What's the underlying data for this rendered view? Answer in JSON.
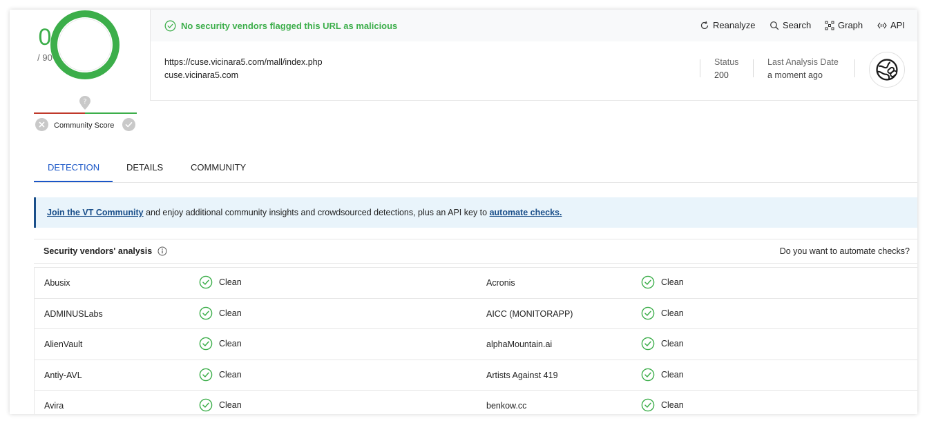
{
  "score": {
    "detections": "0",
    "total": "/ 90"
  },
  "community": {
    "label": "Community Score"
  },
  "header": {
    "verdict": "No security vendors flagged this URL as malicious",
    "actions": [
      {
        "label": "Reanalyze",
        "icon": "refresh-icon"
      },
      {
        "label": "Search",
        "icon": "search-icon"
      },
      {
        "label": "Graph",
        "icon": "graph-icon"
      },
      {
        "label": "API",
        "icon": "api-icon"
      }
    ],
    "url": "https://cuse.vicinara5.com/mall/index.php",
    "domain": "cuse.vicinara5.com",
    "status_label": "Status",
    "status_value": "200",
    "date_label": "Last Analysis Date",
    "date_value": "a moment ago"
  },
  "tabs": [
    {
      "label": "DETECTION",
      "active": true
    },
    {
      "label": "DETAILS",
      "active": false
    },
    {
      "label": "COMMUNITY",
      "active": false
    }
  ],
  "banner": {
    "link1": "Join the VT Community",
    "middle": " and enjoy additional community insights and crowdsourced detections, plus an API key to ",
    "link2": "automate checks."
  },
  "table": {
    "title": "Security vendors' analysis",
    "right": "Do you want to automate checks?",
    "rows": [
      {
        "left_vendor": "Abusix",
        "left_result": "Clean",
        "right_vendor": "Acronis",
        "right_result": "Clean"
      },
      {
        "left_vendor": "ADMINUSLabs",
        "left_result": "Clean",
        "right_vendor": "AICC (MONITORAPP)",
        "right_result": "Clean"
      },
      {
        "left_vendor": "AlienVault",
        "left_result": "Clean",
        "right_vendor": "alphaMountain.ai",
        "right_result": "Clean"
      },
      {
        "left_vendor": "Antiy-AVL",
        "left_result": "Clean",
        "right_vendor": "Artists Against 419",
        "right_result": "Clean"
      },
      {
        "left_vendor": "Avira",
        "left_result": "Clean",
        "right_vendor": "benkow.cc",
        "right_result": "Clean"
      }
    ]
  },
  "colors": {
    "clean": "#3cae4a",
    "accent": "#1a56c7",
    "banner_link": "#1a4f8a"
  }
}
